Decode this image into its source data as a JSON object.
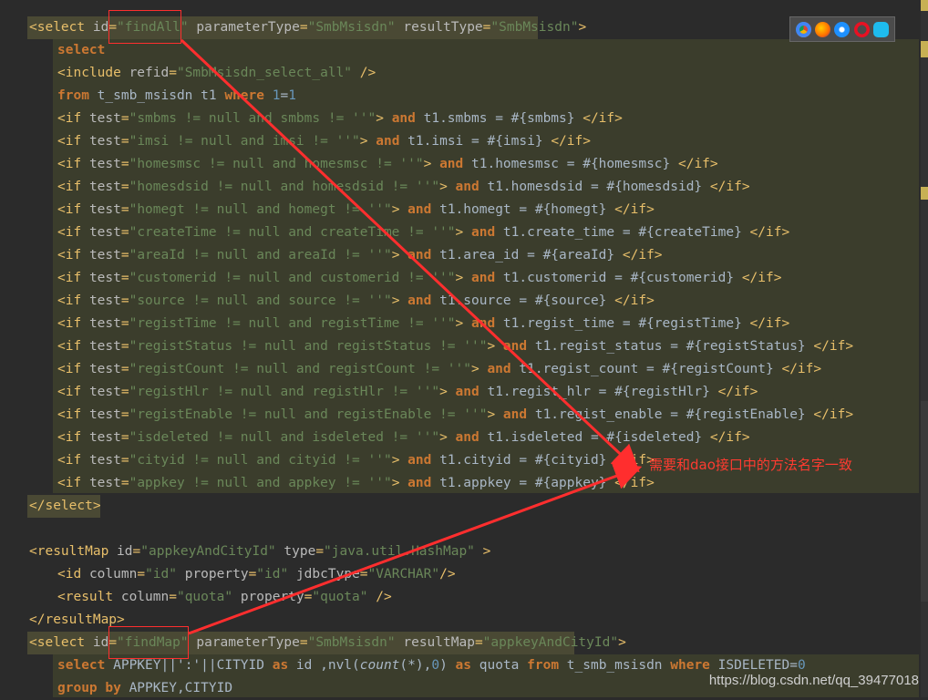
{
  "select1": {
    "open_tag": "<select id=\"findAll\" parameterType=\"SmbMsisdn\" resultType=\"SmbMsisdn\">",
    "id": "findAll",
    "parameterType": "SmbMsisdn",
    "resultType": "SmbMsisdn",
    "lines": [
      "select",
      "<include refid=\"SmbMsisdn_select_all\" />",
      "from t_smb_msisdn t1 where 1=1"
    ],
    "ifs": [
      {
        "test": "smbms != null and smbms != ''",
        "body": "and t1.smbms = #{smbms}"
      },
      {
        "test": "imsi != null and imsi != ''",
        "body": "and t1.imsi = #{imsi}"
      },
      {
        "test": "homesmsc != null and homesmsc != ''",
        "body": "and t1.homesmsc = #{homesmsc}"
      },
      {
        "test": "homesdsid != null and homesdsid != ''",
        "body": "and t1.homesdsid = #{homesdsid}"
      },
      {
        "test": "homegt != null and homegt != ''",
        "body": "and t1.homegt = #{homegt}"
      },
      {
        "test": "createTime != null and createTime != ''",
        "body": "and t1.create_time = #{createTime}"
      },
      {
        "test": "areaId != null and areaId != ''",
        "body": "and t1.area_id = #{areaId}"
      },
      {
        "test": "customerid != null and customerid != ''",
        "body": "and t1.customerid = #{customerid}"
      },
      {
        "test": "source != null and source != ''",
        "body": "and t1.source = #{source}"
      },
      {
        "test": "registTime != null and registTime != ''",
        "body": "and t1.regist_time = #{registTime}"
      },
      {
        "test": "registStatus != null and registStatus != ''",
        "body": "and t1.regist_status = #{registStatus}"
      },
      {
        "test": "registCount != null and registCount != ''",
        "body": "and t1.regist_count = #{registCount}"
      },
      {
        "test": "registHlr != null and registHlr != ''",
        "body": "and t1.regist_hlr = #{registHlr}"
      },
      {
        "test": "registEnable != null and registEnable != ''",
        "body": "and t1.regist_enable = #{registEnable}"
      },
      {
        "test": "isdeleted != null and isdeleted != ''",
        "body": "and t1.isdeleted = #{isdeleted}"
      },
      {
        "test": "cityid != null and cityid != ''",
        "body": "and t1.cityid = #{cityid}"
      },
      {
        "test": "appkey != null and appkey != ''",
        "body": "and t1.appkey = #{appkey}"
      }
    ],
    "close_tag": "</select>"
  },
  "resultMap": {
    "open_tag": "<resultMap id=\"appkeyAndCityId\" type=\"java.util.HashMap\" >",
    "id_line": "<id column=\"id\" property=\"id\" jdbcType=\"VARCHAR\"/>",
    "result_line": "<result column=\"quota\" property=\"quota\" />",
    "close_tag": "</resultMap>"
  },
  "select2": {
    "id": "findMap",
    "parameterType": "SmbMsisdn",
    "resultMap": "appkeyAndCityId",
    "sql_line": "select APPKEY||':'||CITYID as id ,nvl(count(*),0) as quota from t_smb_msisdn where ISDELETED=0",
    "partial_line": "group by APPKEY,CITYID"
  },
  "annotation": "需要和dao接口中的方法名字一致",
  "watermark": "https://blog.csdn.net/qq_39477018",
  "browser_icons": [
    "chrome-icon",
    "firefox-icon",
    "safari-icon",
    "opera-icon",
    "ie-icon"
  ],
  "colors": {
    "background": "#2b2b2b",
    "tag": "#e8bf6a",
    "attr_value": "#6a8759",
    "keyword": "#cc7832",
    "annotation": "#ff3b30"
  }
}
